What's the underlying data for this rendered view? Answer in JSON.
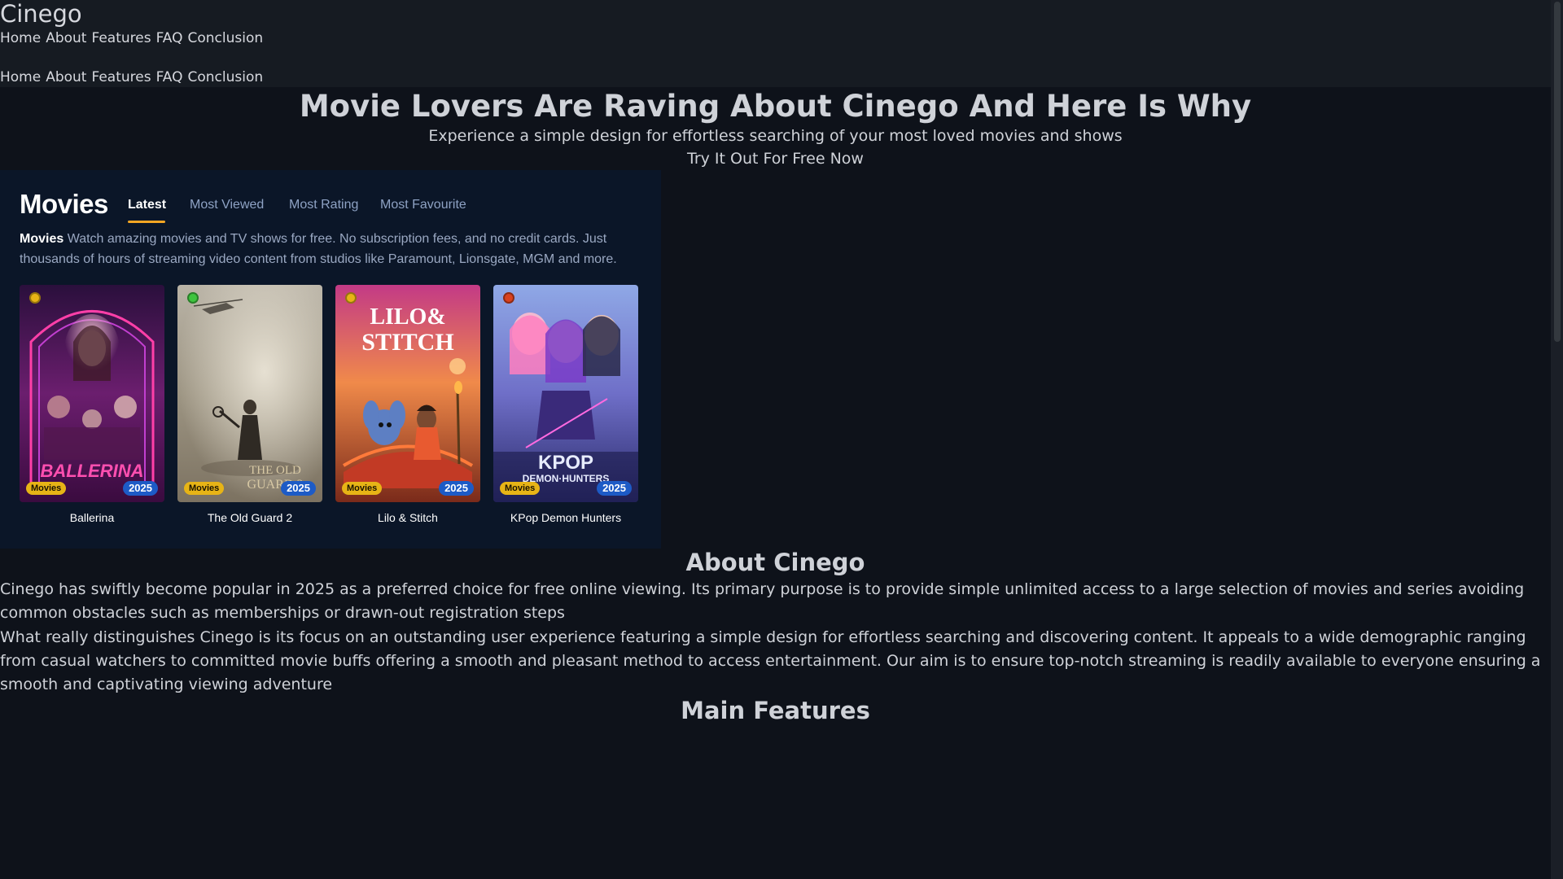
{
  "header": {
    "brand": "Cinego",
    "nav_primary": [
      "Home",
      "About",
      "Features",
      "FAQ",
      "Conclusion"
    ],
    "nav_secondary": [
      "Home",
      "About",
      "Features",
      "FAQ",
      "Conclusion"
    ]
  },
  "hero": {
    "title": "Movie Lovers Are Raving About Cinego And Here Is Why",
    "subtitle": "Experience a simple design for effortless searching of your most loved movies and shows",
    "cta": "Try It Out For Free Now"
  },
  "movies_widget": {
    "heading": "Movies",
    "tabs": [
      "Latest",
      "Most Viewed",
      "Most Rating",
      "Most Favourite"
    ],
    "active_tab": "Latest",
    "desc_lead": "Movies",
    "desc_text": " Watch amazing movies and TV shows for free. No subscription fees, and no credit cards. Just thousands of hours of streaming video content from studios like Paramount, Lionsgate, MGM and more.",
    "accent_color": "#f5a623",
    "cards": [
      {
        "title": "Ballerina",
        "type": "Movies",
        "year": "2025",
        "status_color": "#e7b416",
        "poster_icon": "ballerina-poster"
      },
      {
        "title": "The Old Guard 2",
        "type": "Movies",
        "year": "2025",
        "status_color": "#3ec43e",
        "poster_icon": "old-guard-2-poster"
      },
      {
        "title": "Lilo & Stitch",
        "type": "Movies",
        "year": "2025",
        "status_color": "#e7b416",
        "poster_icon": "lilo-stitch-poster"
      },
      {
        "title": "KPop Demon Hunters",
        "type": "Movies",
        "year": "2025",
        "status_color": "#d9411e",
        "poster_icon": "kpop-demon-hunters-poster"
      }
    ]
  },
  "about": {
    "title": "About Cinego",
    "p1": "Cinego has swiftly become popular in 2025 as a preferred choice for free online viewing. Its primary purpose is to provide simple unlimited access to a large selection of movies and series avoiding common obstacles such as memberships or drawn-out registration steps",
    "p2": "What really distinguishes Cinego is its focus on an outstanding user experience featuring a simple design for effortless searching and discovering content. It appeals to a wide demographic ranging from casual watchers to committed movie buffs offering a smooth and pleasant method to access entertainment. Our aim is to ensure top-notch streaming is readily available to everyone ensuring a smooth and captivating viewing adventure"
  },
  "features": {
    "title": "Main Features"
  }
}
